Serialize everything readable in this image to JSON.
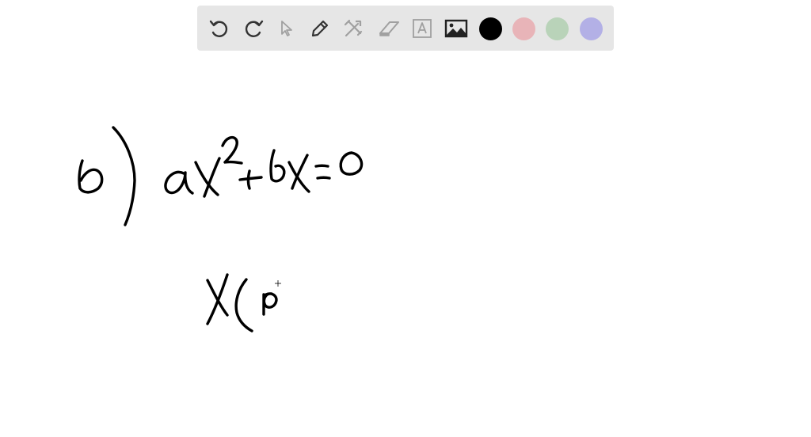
{
  "toolbar": {
    "tools": [
      {
        "name": "undo",
        "icon": "undo-icon",
        "enabled": true
      },
      {
        "name": "redo",
        "icon": "redo-icon",
        "enabled": true
      },
      {
        "name": "select",
        "icon": "cursor-arrow-icon",
        "enabled": false
      },
      {
        "name": "pen",
        "icon": "pencil-icon",
        "enabled": true
      },
      {
        "name": "tools",
        "icon": "crossed-tools-icon",
        "enabled": false
      },
      {
        "name": "eraser",
        "icon": "eraser-icon",
        "enabled": false
      },
      {
        "name": "text",
        "icon": "text-box-icon",
        "enabled": false
      },
      {
        "name": "image",
        "icon": "image-icon",
        "enabled": true
      }
    ],
    "colors": [
      {
        "name": "black",
        "hex": "#000000",
        "selected": true
      },
      {
        "name": "red",
        "hex": "#e8b4b8"
      },
      {
        "name": "green",
        "hex": "#b9d3b9"
      },
      {
        "name": "purple",
        "hex": "#b3b0e6"
      }
    ],
    "icon_color_active": "#333333",
    "icon_color_disabled": "#a0a0a0"
  },
  "canvas": {
    "background": "#ffffff",
    "ink_color": "#000000"
  }
}
